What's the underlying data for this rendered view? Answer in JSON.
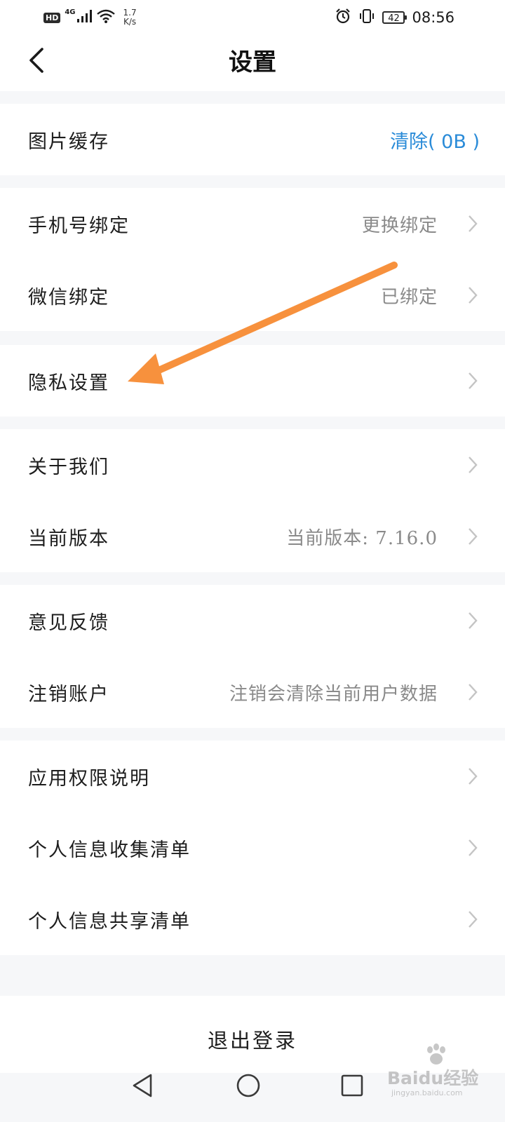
{
  "status_bar": {
    "hd_badge": "HD",
    "network_type": "4G",
    "speed_value": "1.7",
    "speed_unit": "K/s",
    "battery_level": "42",
    "time": "08:56",
    "icons": [
      "signal-icon",
      "wifi-icon",
      "alarm-icon",
      "vibrate-icon",
      "battery-icon"
    ]
  },
  "nav": {
    "title": "设置",
    "back_icon": "chevron-left-icon"
  },
  "groups": [
    {
      "rows": [
        {
          "label": "图片缓存",
          "value": "清除( 0B )",
          "value_style": "action",
          "chevron": false
        }
      ]
    },
    {
      "rows": [
        {
          "label": "手机号绑定",
          "value": "更换绑定",
          "chevron": true
        },
        {
          "label": "微信绑定",
          "value": "已绑定",
          "chevron": true
        }
      ]
    },
    {
      "rows": [
        {
          "label": "隐私设置",
          "value": "",
          "chevron": true
        }
      ]
    },
    {
      "rows": [
        {
          "label": "关于我们",
          "value": "",
          "chevron": true
        },
        {
          "label": "当前版本",
          "value": "当前版本: 7.16.0",
          "chevron": true
        }
      ]
    },
    {
      "rows": [
        {
          "label": "意见反馈",
          "value": "",
          "chevron": true
        },
        {
          "label": "注销账户",
          "value": "注销会清除当前用户数据",
          "chevron": true
        }
      ]
    },
    {
      "rows": [
        {
          "label": "应用权限说明",
          "value": "",
          "chevron": true
        },
        {
          "label": "个人信息收集清单",
          "value": "",
          "chevron": true
        },
        {
          "label": "个人信息共享清单",
          "value": "",
          "chevron": true
        }
      ]
    }
  ],
  "logout": {
    "label": "退出登录"
  },
  "system_nav": {
    "icons": [
      "back-triangle-icon",
      "home-circle-icon",
      "recents-square-icon"
    ]
  },
  "watermark": {
    "brand": "Baidu经验",
    "url": "jingyan.baidu.com"
  },
  "colors": {
    "background": "#f6f7f9",
    "surface": "#ffffff",
    "accent": "#2a8bd8",
    "secondary_text": "#8a8a8a",
    "annotation_arrow": "#f7913d"
  }
}
